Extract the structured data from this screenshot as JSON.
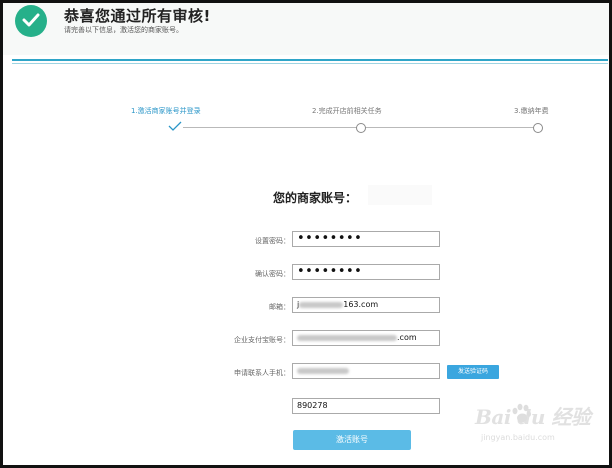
{
  "header": {
    "title": "恭喜您通过所有审核!",
    "subtitle": "请完善以下信息，激活您的商家账号。"
  },
  "steps": [
    {
      "label": "1.激活商家账号并登录"
    },
    {
      "label": "2.完成开店前相关任务"
    },
    {
      "label": "3.缴纳年费"
    }
  ],
  "form": {
    "title": "您的商家账号：",
    "password_label": "设置密码：",
    "password_value": "••••••••",
    "confirm_label": "确认密码：",
    "confirm_value": "••••••••",
    "email_label": "邮箱：",
    "email_prefix": "j",
    "email_suffix": "163.com",
    "alipay_label": "企业支付宝账号：",
    "alipay_suffix": ".com",
    "phone_label": "申请联系人手机：",
    "send_code_label": "发送验证码",
    "code_value": "890278",
    "activate_label": "激活账号"
  },
  "watermark": {
    "brand": "Bai du 经验",
    "url": "jingyan.baidu.com"
  },
  "colors": {
    "accent": "#2a96c8",
    "success": "#26b08a",
    "button": "#5bbbe6"
  }
}
